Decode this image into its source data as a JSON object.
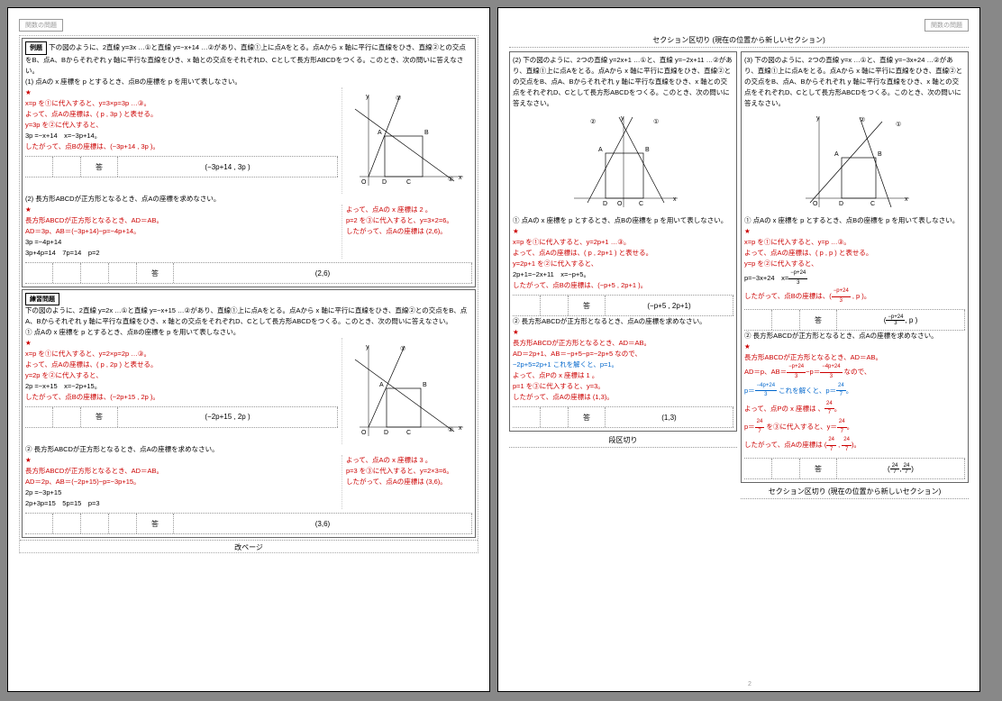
{
  "hdr": {
    "left": "関数の問題",
    "right": "関数の問題"
  },
  "sbreak": "セクション区切り (現在の位置から新しいセクション)",
  "colbreak": "段区切り",
  "pgbreak": "改ページ",
  "pgnum": "2",
  "labels": {
    "reidai": "例題",
    "renshu": "練習問題",
    "kotae": "答"
  },
  "p1": {
    "reidai_q": "下の図のように、2直線 y=3x …①と直線 y=−x+14 …②があり、直線①上に点Aをとる。点Aから x 軸に平行に直線をひき、直線②との交点をB、点A、Bからそれぞれ y 軸に平行な直線をひき、x 軸との交点をそれぞれD、Cとして長方形ABCDをつくる。このとき、次の問いに答えなさい。",
    "q1": "(1) 点Aの x 座標を p とするとき、点Bの座標を p を用いて表しなさい。",
    "s1a": "x=p を①に代入すると、y=3×p=3p …③。",
    "s1b": "よって、点Aの座標は、( p , 3p ) と表せる。",
    "s1c": "y=3p を②に代入すると、",
    "s1d": "3p =−x+14　x=−3p+14。",
    "s1e": "したがって、点Bの座標は、(−3p+14 , 3p )。",
    "a1": "(−3p+14 , 3p )",
    "q2": "(2) 長方形ABCDが正方形となるとき、点Aの座標を求めなさい。",
    "s2a": "長方形ABCDが正方形となるとき、AD＝AB。",
    "s2b": "AD＝3p、AB＝(−3p+14)−p=−4p+14。",
    "s2c": "3p =−4p+14",
    "s2d": "3p+4p=14　7p=14　p=2",
    "s2e": "よって、点Aの x 座標は 2 。",
    "s2f": "p=2 を③に代入すると、y=3×2=6。",
    "s2g": "したがって、点Aの座標は (2,6)。",
    "a2": "(2,6)",
    "renshu_q": "下の図のように、2直線 y=2x …①と直線 y=−x+15 …②があり、直線①上に点Aをとる。点Aから x 軸に平行に直線をひき、直線②との交点をB、点A、Bからそれぞれ y 軸に平行な直線をひき、x 軸との交点をそれぞれD、Cとして長方形ABCDをつくる。このとき、次の問いに答えなさい。",
    "rq1": "① 点Aの x 座標を p とするとき、点Bの座標を p を用いて表しなさい。",
    "rs1a": "x=p を①に代入すると、y=2×p=2p …③。",
    "rs1b": "よって、点Aの座標は、( p , 2p ) と表せる。",
    "rs1c": "y=2p を②に代入すると、",
    "rs1d": "2p =−x+15　x=−2p+15。",
    "rs1e": "したがって、点Bの座標は、(−2p+15 , 2p )。",
    "ra1": "(−2p+15 , 2p )",
    "rq2": "② 長方形ABCDが正方形となるとき、点Aの座標を求めなさい。",
    "rs2a": "長方形ABCDが正方形となるとき、AD＝AB。",
    "rs2b": "AD＝2p、AB＝(−2p+15)−p=−3p+15。",
    "rs2c": "2p =−3p+15",
    "rs2d": "2p+3p=15　5p=15　p=3",
    "rs2e": "よって、点Aの x 座標は 3 。",
    "rs2f": "p=3 を③に代入すると、y=2×3=6。",
    "rs2g": "したがって、点Aの座標は (3,6)。",
    "ra2": "(3,6)"
  },
  "p2": {
    "l": {
      "q": "(2) 下の図のように、2つの直線 y=2x+1 …①と、直線 y=−2x+11 …②があり、直線①上に点Aをとる。点Aから x 軸に平行に直線をひき、直線②との交点をB、点A、Bからそれぞれ y 軸に平行な直線をひき、x 軸との交点をそれぞれD、Cとして長方形ABCDをつくる。このとき、次の問いに答えなさい。",
      "q1": "① 点Aの x 座標を p とするとき、点Bの座標を p を用いて表しなさい。",
      "s1a": "x=p を①に代入すると、y=2p+1 …③。",
      "s1b": "よって、点Aの座標は、( p , 2p+1 ) と表せる。",
      "s1c": "y=2p+1 を②に代入すると、",
      "s1d": "2p+1=−2x+11　x=−p+5。",
      "s1e": "したがって、点Bの座標は、(−p+5 , 2p+1 )。",
      "a1": "(−p+5 , 2p+1)",
      "q2": "② 長方形ABCDが正方形となるとき、点Aの座標を求めなさい。",
      "s2a": "長方形ABCDが正方形となるとき、AD＝AB。",
      "s2b": "AD＝2p+1、AB＝−p+5−p=−2p+5 なので、",
      "s2c": "−2p+5=2p+1 これを解くと、p=1。",
      "s2d": "よって、点Pの x 座標は 1 。",
      "s2e": "p=1 を③に代入すると、y=3。",
      "s2f": "したがって、点Aの座標は (1,3)。",
      "a2": "(1,3)"
    },
    "r": {
      "q": "(3) 下の図のように、2つの直線 y=x …①と、直線 y=−3x+24 …②があり、直線①上に点Aをとる。点Aから x 軸に平行に直線をひき、直線②との交点をB、点A、Bからそれぞれ y 軸に平行な直線をひき、x 軸との交点をそれぞれD、Cとして長方形ABCDをつくる。このとき、次の問いに答えなさい。",
      "q1": "① 点Aの x 座標を p とするとき、点Bの座標を p を用いて表しなさい。",
      "s1a": "x=p を①に代入すると、y=p …③。",
      "s1b": "よって、点Aの座標は、( p , p ) と表せる。",
      "s1c": "y=p を②に代入すると、",
      "s1e": "したがって、点Bの座標は、",
      "q2": "② 長方形ABCDが正方形となるとき、点Aの座標を求めなさい。",
      "s2a": "長方形ABCDが正方形となるとき、AD＝AB。",
      "s2d": "よって、点Pの x 座標は 、",
      "s2f": "したがって、点Aの座標は "
    }
  },
  "graph": {
    "A": "A",
    "B": "B",
    "C": "C",
    "D": "D",
    "O": "O",
    "x": "x",
    "y": "y",
    "one": "①",
    "two": "②"
  }
}
